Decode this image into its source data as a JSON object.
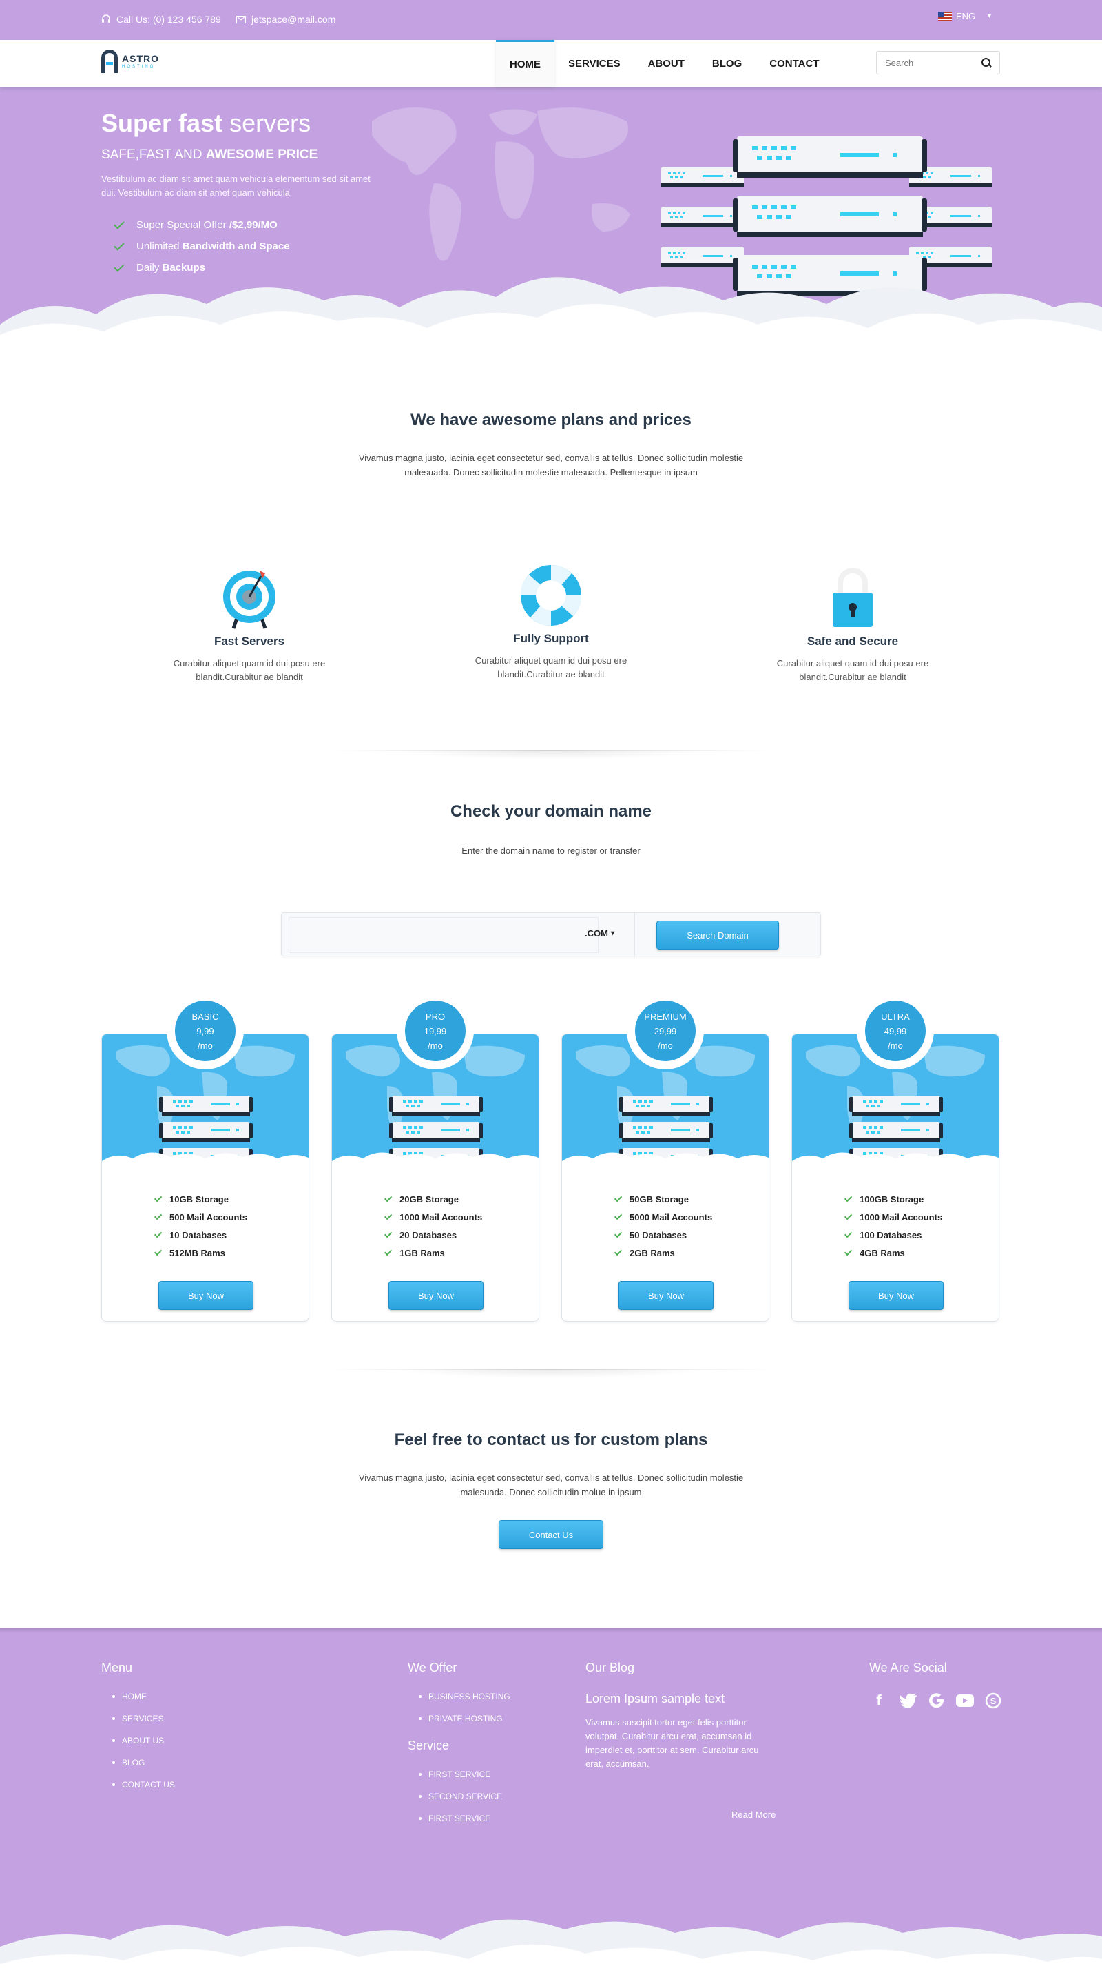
{
  "topbar": {
    "phone": "Call Us: (0) 123 456 789",
    "email": "jetspace@mail.com",
    "language": "ENG"
  },
  "brand": {
    "name": "ASTRO",
    "tagline": "HOSTING"
  },
  "nav": {
    "items": [
      "HOME",
      "SERVICES",
      "ABOUT",
      "BLOG",
      "CONTACT"
    ],
    "search_placeholder": "Search"
  },
  "hero": {
    "title_bold": "Super fast",
    "title_light": "servers",
    "subtitle_plain": "SAFE,FAST AND",
    "subtitle_bold": "AWESOME PRICE",
    "description": "Vestibulum ac diam sit amet quam vehicula elementum sed sit amet dui. Vestibulum ac diam sit amet quam vehicula",
    "checks": [
      {
        "plain": "Super Special Offer",
        "bold": "/$2,99/MO"
      },
      {
        "plain": "Unlimited",
        "bold": "Bandwidth and Space"
      },
      {
        "plain": "Daily",
        "bold": "Backups"
      }
    ]
  },
  "plans_intro": {
    "title": "We have awesome plans and prices",
    "text": "Vivamus magna justo, lacinia eget consectetur sed, convallis at tellus. Donec sollicitudin molestie malesuada. Donec sollicitudin molestie malesuada. Pellentesque in ipsum"
  },
  "features": [
    {
      "icon": "target-icon",
      "title": "Fast Servers",
      "text": "Curabitur aliquet quam id dui posu ere blandit.Curabitur ae blandit"
    },
    {
      "icon": "lifebuoy-icon",
      "title": "Fully Support",
      "text": "Curabitur aliquet quam id dui posu ere blandit.Curabitur ae blandit"
    },
    {
      "icon": "padlock-icon",
      "title": "Safe and Secure",
      "text": "Curabitur aliquet quam id dui posu ere blandit.Curabitur ae blandit"
    }
  ],
  "domain": {
    "title": "Check your domain name",
    "subtitle": "Enter the domain name to register or transfer",
    "tld": ".COM",
    "button": "Search Domain"
  },
  "plans": [
    {
      "name": "BASIC",
      "price": "9,99",
      "period": "/mo",
      "features": [
        "10GB Storage",
        "500 Mail Accounts",
        "10 Databases",
        "512MB Rams"
      ],
      "button": "Buy Now"
    },
    {
      "name": "PRO",
      "price": "19,99",
      "period": "/mo",
      "features": [
        "20GB Storage",
        "1000 Mail Accounts",
        "20 Databases",
        "1GB Rams"
      ],
      "button": "Buy Now"
    },
    {
      "name": "PREMIUM",
      "price": "29,99",
      "period": "/mo",
      "features": [
        "50GB Storage",
        "5000 Mail Accounts",
        "50 Databases",
        "2GB Rams"
      ],
      "button": "Buy Now"
    },
    {
      "name": "ULTRA",
      "price": "49,99",
      "period": "/mo",
      "features": [
        "100GB Storage",
        "1000 Mail Accounts",
        "100 Databases",
        "4GB Rams"
      ],
      "button": "Buy Now"
    }
  ],
  "contact": {
    "title": "Feel free to contact us for custom plans",
    "text": "Vivamus magna justo, lacinia eget consectetur sed, convallis at tellus. Donec sollicitudin molestie malesuada. Donec sollicitudin molue in ipsum",
    "button": "Contact Us"
  },
  "footer": {
    "menu": {
      "title": "Menu",
      "items": [
        "HOME",
        "SERVICES",
        "ABOUT US",
        "BLOG",
        "CONTACT US"
      ]
    },
    "offer": {
      "title": "We Offer",
      "items": [
        "BUSINESS HOSTING",
        "PRIVATE HOSTING"
      ]
    },
    "service": {
      "title": "Service",
      "items": [
        "FIRST SERVICE",
        "SECOND SERVICE",
        "FIRST SERVICE"
      ]
    },
    "blog": {
      "title": "Our Blog",
      "post_title": "Lorem Ipsum sample text",
      "post_text": "Vivamus suscipit tortor eget felis porttitor volutpat. Curabitur arcu erat, accumsan id imperdiet et, porttitor at sem. Curabitur arcu erat, accumsan.",
      "read_more": "Read More"
    },
    "social": {
      "title": "We Are Social",
      "icons": [
        "facebook-icon",
        "twitter-icon",
        "google-icon",
        "youtube-icon",
        "skype-icon"
      ]
    }
  },
  "colors": {
    "brand_purple": "#c4a2e2",
    "accent_blue": "#2ea3dc",
    "check_green": "#4caf50"
  }
}
